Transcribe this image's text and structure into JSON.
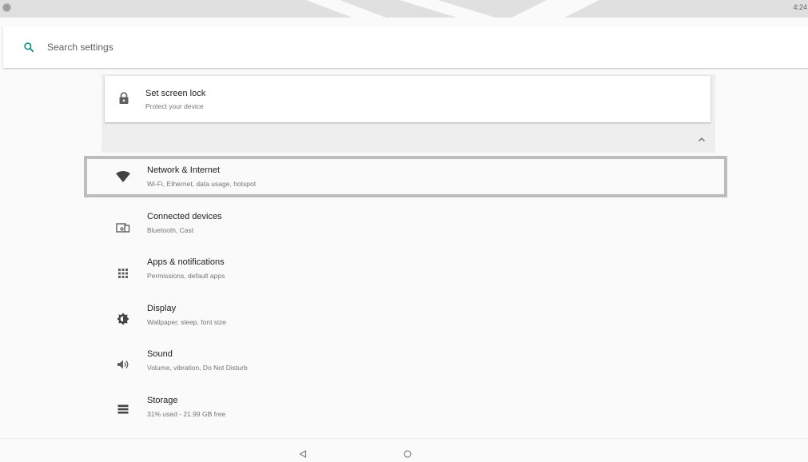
{
  "status_bar": {
    "time": "4:24"
  },
  "search": {
    "placeholder": "Search settings",
    "icon": "search-icon",
    "accent_color": "#00897b"
  },
  "suggestion": {
    "title": "Set screen lock",
    "summary": "Protect your device",
    "icon": "lock-icon"
  },
  "settings": [
    {
      "title": "Network & Internet",
      "summary": "Wi-Fi, Ethernet, data usage, hotspot",
      "icon": "wifi-icon"
    },
    {
      "title": "Connected devices",
      "summary": "Bluetooth, Cast",
      "icon": "devices-icon"
    },
    {
      "title": "Apps & notifications",
      "summary": "Permissions, default apps",
      "icon": "apps-icon"
    },
    {
      "title": "Display",
      "summary": "Wallpaper, sleep, font size",
      "icon": "brightness-icon"
    },
    {
      "title": "Sound",
      "summary": "Volume, vibration, Do Not Disturb",
      "icon": "volume-icon"
    },
    {
      "title": "Storage",
      "summary": "31% used - 21.99 GB free",
      "icon": "storage-icon"
    }
  ],
  "nav": {
    "back_icon": "back-triangle-icon",
    "home_icon": "home-circle-icon"
  }
}
